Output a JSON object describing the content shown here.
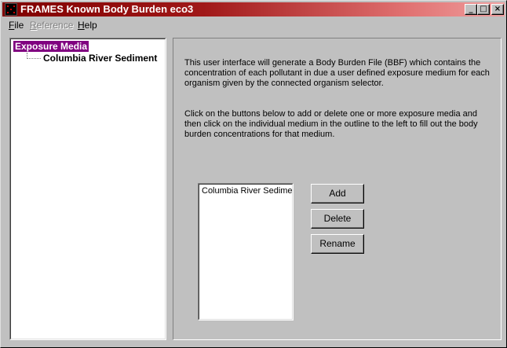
{
  "window": {
    "title": "FRAMES Known Body Burden eco3",
    "controls": {
      "minimize": "_",
      "maximize": "□",
      "close": "×"
    }
  },
  "menu": [
    {
      "label": "File",
      "accel": "F",
      "rest": "ile",
      "enabled": true
    },
    {
      "label": "Reference",
      "accel": "R",
      "rest": "eference",
      "enabled": false
    },
    {
      "label": "Help",
      "accel": "H",
      "rest": "elp",
      "enabled": true
    }
  ],
  "tree": {
    "root": "Exposure Media",
    "children": [
      "Columbia River Sediment"
    ]
  },
  "panel": {
    "description_1": "This user interface will generate a Body Burden File (BBF) which contains the concentration of each pollutant in due a user defined exposure medium for each organism given by the connected organism selector.",
    "description_2": "Click on the buttons below to add or delete one or more exposure media and then click on the individual medium in the outline to the left to fill out the body burden concentrations for that medium.",
    "media_list": [
      "Columbia River Sedimen"
    ],
    "buttons": {
      "add": "Add",
      "delete": "Delete",
      "rename": "Rename"
    }
  },
  "colors": {
    "title_gradient_start": "#800000",
    "title_gradient_end": "#f0a0a0",
    "selection": "#800080",
    "face": "#c0c0c0"
  }
}
